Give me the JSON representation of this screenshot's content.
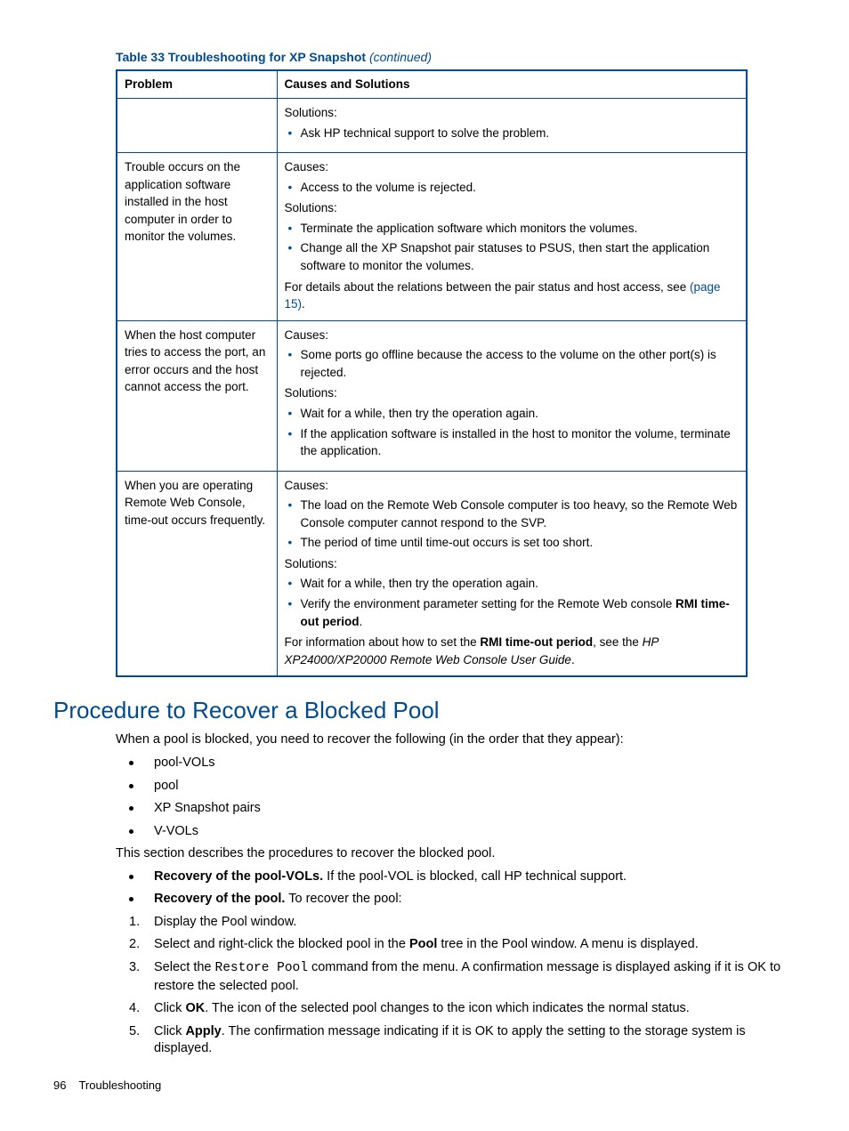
{
  "table": {
    "caption_prefix": "Table 33 Troubleshooting for XP Snapshot ",
    "caption_suffix": "(continued)",
    "header_problem": "Problem",
    "header_causes": "Causes and Solutions",
    "row0": {
      "problem": "",
      "sol_label": "Solutions:",
      "sol_item0": "Ask HP technical support to solve the problem."
    },
    "row1": {
      "problem": "Trouble occurs on the application software installed in the host computer in order to monitor the volumes.",
      "cause_label": "Causes:",
      "cause_item0": "Access to the volume is rejected.",
      "sol_label": "Solutions:",
      "sol_item0": "Terminate the application software which monitors the volumes.",
      "sol_item1": "Change all the XP Snapshot pair statuses to PSUS, then start the application software to monitor the volumes.",
      "note_pre": "For details about the relations between the pair status and host access, see ",
      "note_link": "(page 15)",
      "note_post": "."
    },
    "row2": {
      "problem": "When the host computer tries to access the port, an error occurs and the host cannot access the port.",
      "cause_label": "Causes:",
      "cause_item0": "Some ports go offline because the access to the volume on the other port(s) is rejected.",
      "sol_label": "Solutions:",
      "sol_item0": "Wait for a while, then try the operation again.",
      "sol_item1": "If the application software is installed in the host to monitor the volume, terminate the application."
    },
    "row3": {
      "problem": "When you are operating Remote Web Console, time-out occurs frequently.",
      "cause_label": "Causes:",
      "cause_item0": "The load on the Remote Web Console computer is too heavy, so the Remote Web Console computer cannot respond to the SVP.",
      "cause_item1": "The period of time until time-out occurs is set too short.",
      "sol_label": "Solutions:",
      "sol_item0": "Wait for a while, then try the operation again.",
      "sol_item1_pre": "Verify the environment parameter setting for the Remote Web console ",
      "sol_item1_bold": "RMI time-out period",
      "sol_item1_post": ".",
      "note_pre": "For information about how to set the ",
      "note_bold": "RMI time-out period",
      "note_mid": ", see the ",
      "note_italic": "HP XP24000/XP20000 Remote Web Console User Guide",
      "note_post": "."
    }
  },
  "section": {
    "heading": "Procedure to Recover a Blocked Pool",
    "intro": "When a pool is blocked, you need to recover the following (in the order that they appear):",
    "item0": "pool-VOLs",
    "item1": "pool",
    "item2": "XP Snapshot pairs",
    "item3": "V-VOLs",
    "desc": "This section describes the procedures to recover the blocked pool.",
    "rec0_bold": "Recovery of the pool-VOLs.",
    "rec0_text": " If the pool-VOL is blocked, call HP technical support.",
    "rec1_bold": "Recovery of the pool.",
    "rec1_text": " To recover the pool:",
    "step1": "Display the Pool window.",
    "step2_pre": "Select and right-click the blocked pool in the ",
    "step2_bold": "Pool",
    "step2_post": " tree in the Pool window. A menu is displayed.",
    "step3_pre": "Select the ",
    "step3_mono": "Restore Pool",
    "step3_post": " command from the menu. A confirmation message is displayed asking if it is OK to restore the selected pool.",
    "step4_pre": "Click ",
    "step4_bold": "OK",
    "step4_post": ". The icon of the selected pool changes to the icon which indicates the normal status.",
    "step5_pre": "Click ",
    "step5_bold": "Apply",
    "step5_post": ". The confirmation message indicating if it is OK to apply the setting to the storage system is displayed."
  },
  "footer": {
    "page": "96",
    "chapter": "Troubleshooting"
  }
}
